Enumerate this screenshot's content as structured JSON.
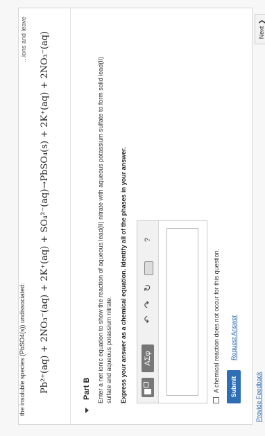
{
  "previous": {
    "top_text": "the insoluble species (PbSO4(s)) undissociated:",
    "top_right_text": "...ions and leave",
    "equation": "Pb²⁺(aq) + 2NO₃⁻(aq) + 2K⁺(aq) + SO₄²⁻(aq)→PbSO₄(s) + 2K⁺(aq) + 2NO₃⁻(aq)"
  },
  "part": {
    "title": "Part B"
  },
  "instructions": "Enter a net ionic equation to show the reaction of aqueous lead(II) nitrate with aqueous potassium sulfate to form solid lead(II) sulfate and aqueous potassium nitrate.",
  "express": "Express your answer as a chemical equation. Identify all of the phases in your answer.",
  "toolbar": {
    "greek_label": "AΣφ",
    "undo_symbol": "↶",
    "redo_symbol": "↷",
    "reset_symbol": "↻",
    "help_symbol": "?"
  },
  "answer": {
    "value": ""
  },
  "no_reaction_label": "A chemical reaction does not occur for this question.",
  "buttons": {
    "submit": "Submit",
    "request": "Request Answer",
    "next": "Next ❯"
  },
  "footer": {
    "feedback": "Provide Feedback"
  },
  "colors": {
    "submit_bg": "#2d6eb5",
    "link": "#2f6db0",
    "toolbar_btn": "#777777"
  }
}
